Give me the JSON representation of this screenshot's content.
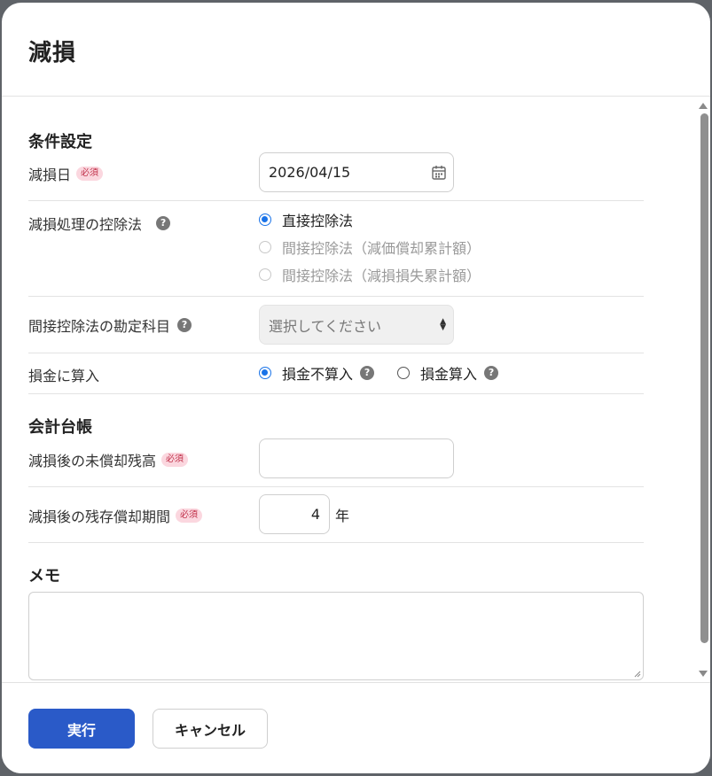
{
  "dialog": {
    "title": "減損"
  },
  "sections": {
    "conditions": "条件設定",
    "ledger": "会計台帳",
    "memo": "メモ"
  },
  "badges": {
    "required": "必須"
  },
  "fields": {
    "impairment_date": {
      "label": "減損日",
      "value": "2026/04/15"
    },
    "deduction_method": {
      "label": "減損処理の控除法",
      "options": [
        {
          "label": "直接控除法",
          "checked": true,
          "disabled": false
        },
        {
          "label": "間接控除法（減価償却累計額）",
          "checked": false,
          "disabled": true
        },
        {
          "label": "間接控除法（減損損失累計額）",
          "checked": false,
          "disabled": true
        }
      ]
    },
    "indirect_account": {
      "label": "間接控除法の勘定科目",
      "placeholder": "選択してください"
    },
    "loss_inclusion": {
      "label": "損金に算入",
      "options": [
        {
          "label": "損金不算入",
          "checked": true
        },
        {
          "label": "損金算入",
          "checked": false
        }
      ]
    },
    "remaining_book_value": {
      "label": "減損後の未償却残高",
      "value": ""
    },
    "remaining_life": {
      "label": "減損後の残存償却期間",
      "value": "4",
      "unit": "年"
    },
    "memo": {
      "value": ""
    }
  },
  "footer": {
    "execute_label": "実行",
    "cancel_label": "キャンセル"
  },
  "colors": {
    "primary": "#2a5ac8",
    "radio_checked": "#1a73e8",
    "required_badge_bg": "#fbd7df",
    "required_badge_text": "#c0314a"
  },
  "icons": {
    "date_picker": "calendar-icon",
    "help": "question-circle-icon",
    "select": "select-arrows-icon"
  }
}
